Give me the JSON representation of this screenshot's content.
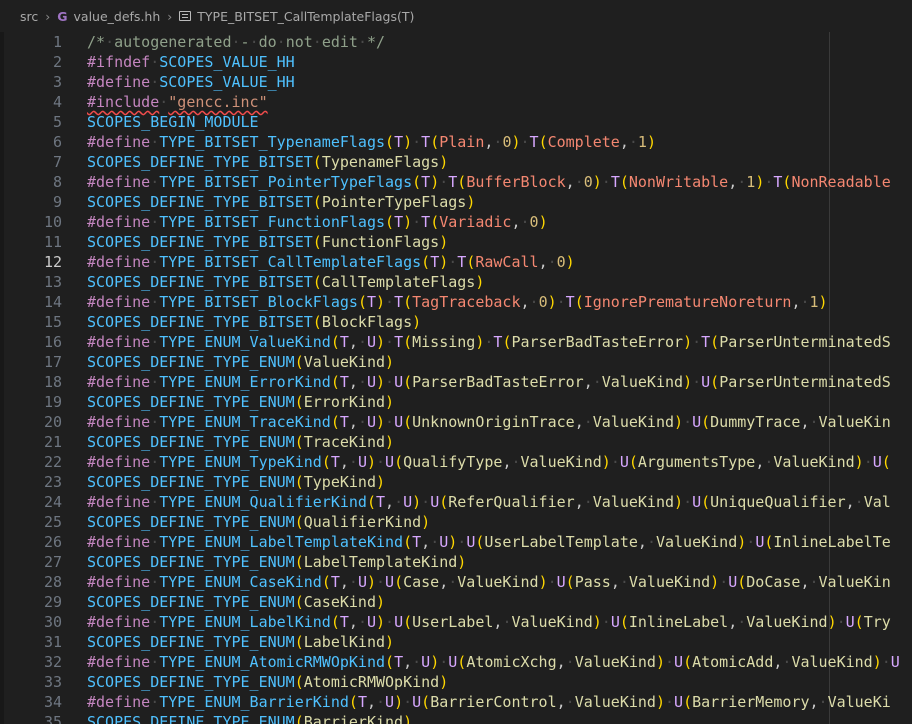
{
  "breadcrumb": {
    "folder": "src",
    "file": "value_defs.hh",
    "symbol": "TYPE_BITSET_CallTemplateFlags(T)"
  },
  "editor": {
    "active_line": 12,
    "lines": [
      {
        "n": "1",
        "t": "/* autogenerated - do not edit */"
      },
      {
        "n": "2",
        "t": "#ifndef SCOPES_VALUE_HH"
      },
      {
        "n": "3",
        "t": "#define SCOPES_VALUE_HH"
      },
      {
        "n": "4",
        "t": "#include \"gencc.inc\""
      },
      {
        "n": "5",
        "t": "SCOPES_BEGIN_MODULE"
      },
      {
        "n": "6",
        "t": "#define TYPE_BITSET_TypenameFlags(T) T(Plain, 0) T(Complete, 1)"
      },
      {
        "n": "7",
        "t": "SCOPES_DEFINE_TYPE_BITSET(TypenameFlags)"
      },
      {
        "n": "8",
        "t": "#define TYPE_BITSET_PointerTypeFlags(T) T(BufferBlock, 0) T(NonWritable, 1) T(NonReadable"
      },
      {
        "n": "9",
        "t": "SCOPES_DEFINE_TYPE_BITSET(PointerTypeFlags)"
      },
      {
        "n": "10",
        "t": "#define TYPE_BITSET_FunctionFlags(T) T(Variadic, 0)"
      },
      {
        "n": "11",
        "t": "SCOPES_DEFINE_TYPE_BITSET(FunctionFlags)"
      },
      {
        "n": "12",
        "t": "#define TYPE_BITSET_CallTemplateFlags(T) T(RawCall, 0)"
      },
      {
        "n": "13",
        "t": "SCOPES_DEFINE_TYPE_BITSET(CallTemplateFlags)"
      },
      {
        "n": "14",
        "t": "#define TYPE_BITSET_BlockFlags(T) T(TagTraceback, 0) T(IgnorePrematureNoreturn, 1)"
      },
      {
        "n": "15",
        "t": "SCOPES_DEFINE_TYPE_BITSET(BlockFlags)"
      },
      {
        "n": "16",
        "t": "#define TYPE_ENUM_ValueKind(T, U) T(Missing) T(ParserBadTasteError) T(ParserUnterminatedS"
      },
      {
        "n": "17",
        "t": "SCOPES_DEFINE_TYPE_ENUM(ValueKind)"
      },
      {
        "n": "18",
        "t": "#define TYPE_ENUM_ErrorKind(T, U) U(ParserBadTasteError, ValueKind) U(ParserUnterminatedS"
      },
      {
        "n": "19",
        "t": "SCOPES_DEFINE_TYPE_ENUM(ErrorKind)"
      },
      {
        "n": "20",
        "t": "#define TYPE_ENUM_TraceKind(T, U) U(UnknownOriginTrace, ValueKind) U(DummyTrace, ValueKin"
      },
      {
        "n": "21",
        "t": "SCOPES_DEFINE_TYPE_ENUM(TraceKind)"
      },
      {
        "n": "22",
        "t": "#define TYPE_ENUM_TypeKind(T, U) U(QualifyType, ValueKind) U(ArgumentsType, ValueKind) U("
      },
      {
        "n": "23",
        "t": "SCOPES_DEFINE_TYPE_ENUM(TypeKind)"
      },
      {
        "n": "24",
        "t": "#define TYPE_ENUM_QualifierKind(T, U) U(ReferQualifier, ValueKind) U(UniqueQualifier, Val"
      },
      {
        "n": "25",
        "t": "SCOPES_DEFINE_TYPE_ENUM(QualifierKind)"
      },
      {
        "n": "26",
        "t": "#define TYPE_ENUM_LabelTemplateKind(T, U) U(UserLabelTemplate, ValueKind) U(InlineLabelTe"
      },
      {
        "n": "27",
        "t": "SCOPES_DEFINE_TYPE_ENUM(LabelTemplateKind)"
      },
      {
        "n": "28",
        "t": "#define TYPE_ENUM_CaseKind(T, U) U(Case, ValueKind) U(Pass, ValueKind) U(DoCase, ValueKin"
      },
      {
        "n": "29",
        "t": "SCOPES_DEFINE_TYPE_ENUM(CaseKind)"
      },
      {
        "n": "30",
        "t": "#define TYPE_ENUM_LabelKind(T, U) U(UserLabel, ValueKind) U(InlineLabel, ValueKind) U(Try"
      },
      {
        "n": "31",
        "t": "SCOPES_DEFINE_TYPE_ENUM(LabelKind)"
      },
      {
        "n": "32",
        "t": "#define TYPE_ENUM_AtomicRMWOpKind(T, U) U(AtomicXchg, ValueKind) U(AtomicAdd, ValueKind) U"
      },
      {
        "n": "33",
        "t": "SCOPES_DEFINE_TYPE_ENUM(AtomicRMWOpKind)"
      },
      {
        "n": "34",
        "t": "#define TYPE_ENUM_BarrierKind(T, U) U(BarrierControl, ValueKind) U(BarrierMemory, ValueKi"
      },
      {
        "n": "35",
        "t": "SCOPES_DEFINE_TYPE_ENUM(BarrierKind)"
      }
    ]
  }
}
